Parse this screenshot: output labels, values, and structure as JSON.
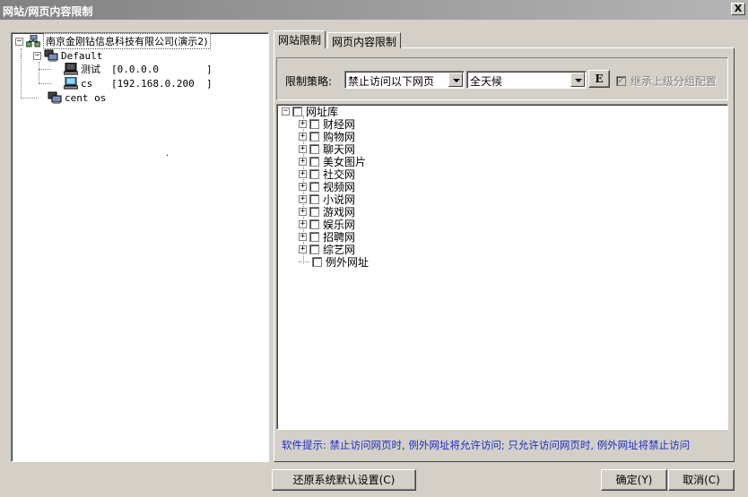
{
  "window": {
    "title": "网站/网页内容限制",
    "close_glyph": "X"
  },
  "left_tree": {
    "root": {
      "label": "南京金刚钻信息科技有限公司(演示2)",
      "expander": "−"
    },
    "groups": [
      {
        "label": "Default",
        "expander": "−",
        "members": [
          {
            "name": "测试",
            "ip": "[0.0.0.0        ]"
          },
          {
            "name": "cs",
            "ip": "[192.168.0.200  ]"
          }
        ]
      },
      {
        "label": "cent os",
        "expander": ""
      }
    ],
    "dot": "·"
  },
  "tabs": [
    {
      "label": "网站限制",
      "active": true
    },
    {
      "label": "网页内容限制",
      "active": false
    }
  ],
  "policy": {
    "label": "限制策略:",
    "mode_value": "禁止访问以下网页",
    "time_value": "全天候",
    "edit_button": "E",
    "inherit_label": "继承上级分组配置",
    "inherit_checked": true
  },
  "url_tree": {
    "root_label": "网址库",
    "root_expander": "−",
    "categories": [
      "财经网",
      "购物网",
      "聊天网",
      "美女图片",
      "社交网",
      "视频网",
      "小说网",
      "游戏网",
      "娱乐网",
      "招聘网",
      "综艺网"
    ],
    "category_expander": "+",
    "exception_label": "例外网址"
  },
  "hint": "软件提示: 禁止访问网页时, 例外网址将允许访问; 只允许访问网页时, 例外网址将禁止访问",
  "buttons": {
    "restore": "还原系统默认设置(C)",
    "ok": "确定(Y)",
    "cancel": "取消(C)"
  }
}
